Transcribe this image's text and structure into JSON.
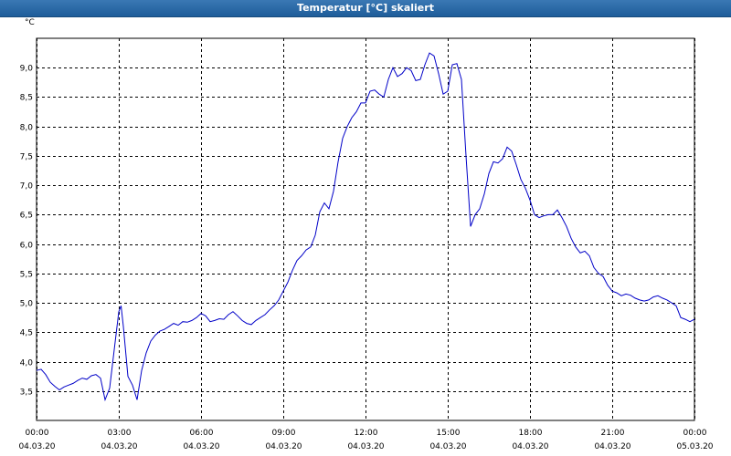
{
  "window": {
    "title": "Temperatur [°C] skaliert"
  },
  "chart_data": {
    "type": "line",
    "title": "Temperatur [°C] skaliert",
    "xlabel": "",
    "ylabel": "°C",
    "x_range_hours": [
      0,
      24
    ],
    "ylim": [
      3.0,
      9.5
    ],
    "grid": true,
    "line_color": "#0000c8",
    "y_ticks": [
      "3,5",
      "4,0",
      "4,5",
      "5,0",
      "5,5",
      "6,0",
      "6,5",
      "7,0",
      "7,5",
      "8,0",
      "8,5",
      "9,0"
    ],
    "x_ticks": [
      {
        "time": "00:00",
        "date": "04.03.20"
      },
      {
        "time": "03:00",
        "date": "04.03.20"
      },
      {
        "time": "06:00",
        "date": "04.03.20"
      },
      {
        "time": "09:00",
        "date": "04.03.20"
      },
      {
        "time": "12:00",
        "date": "04.03.20"
      },
      {
        "time": "15:00",
        "date": "04.03.20"
      },
      {
        "time": "18:00",
        "date": "04.03.20"
      },
      {
        "time": "21:00",
        "date": "04.03.20"
      },
      {
        "time": "00:00",
        "date": "05.03.20"
      }
    ],
    "series": [
      {
        "points": [
          [
            "04.03.20 00:00",
            3.85
          ],
          [
            "04.03.20 00:10",
            3.87
          ],
          [
            "04.03.20 00:20",
            3.78
          ],
          [
            "04.03.20 00:30",
            3.65
          ],
          [
            "04.03.20 00:40",
            3.58
          ],
          [
            "04.03.20 00:50",
            3.52
          ],
          [
            "04.03.20 01:00",
            3.57
          ],
          [
            "04.03.20 01:10",
            3.6
          ],
          [
            "04.03.20 01:20",
            3.63
          ],
          [
            "04.03.20 01:30",
            3.68
          ],
          [
            "04.03.20 01:40",
            3.72
          ],
          [
            "04.03.20 01:50",
            3.7
          ],
          [
            "04.03.20 02:00",
            3.76
          ],
          [
            "04.03.20 02:10",
            3.78
          ],
          [
            "04.03.20 02:20",
            3.72
          ],
          [
            "04.03.20 02:30",
            3.35
          ],
          [
            "04.03.20 02:40",
            3.55
          ],
          [
            "04.03.20 02:50",
            4.2
          ],
          [
            "04.03.20 03:00",
            4.85
          ],
          [
            "04.03.20 03:05",
            4.95
          ],
          [
            "04.03.20 03:10",
            4.6
          ],
          [
            "04.03.20 03:20",
            3.75
          ],
          [
            "04.03.20 03:30",
            3.6
          ],
          [
            "04.03.20 03:40",
            3.35
          ],
          [
            "04.03.20 03:50",
            3.85
          ],
          [
            "04.03.20 04:00",
            4.15
          ],
          [
            "04.03.20 04:10",
            4.35
          ],
          [
            "04.03.20 04:20",
            4.45
          ],
          [
            "04.03.20 04:30",
            4.52
          ],
          [
            "04.03.20 04:40",
            4.55
          ],
          [
            "04.03.20 04:50",
            4.6
          ],
          [
            "04.03.20 05:00",
            4.65
          ],
          [
            "04.03.20 05:10",
            4.62
          ],
          [
            "04.03.20 05:20",
            4.68
          ],
          [
            "04.03.20 05:30",
            4.67
          ],
          [
            "04.03.20 05:40",
            4.7
          ],
          [
            "04.03.20 05:50",
            4.75
          ],
          [
            "04.03.20 06:00",
            4.82
          ],
          [
            "04.03.20 06:10",
            4.78
          ],
          [
            "04.03.20 06:20",
            4.68
          ],
          [
            "04.03.20 06:30",
            4.7
          ],
          [
            "04.03.20 06:40",
            4.73
          ],
          [
            "04.03.20 06:50",
            4.72
          ],
          [
            "04.03.20 07:00",
            4.8
          ],
          [
            "04.03.20 07:10",
            4.85
          ],
          [
            "04.03.20 07:20",
            4.78
          ],
          [
            "04.03.20 07:30",
            4.7
          ],
          [
            "04.03.20 07:40",
            4.65
          ],
          [
            "04.03.20 07:50",
            4.63
          ],
          [
            "04.03.20 08:00",
            4.7
          ],
          [
            "04.03.20 08:10",
            4.75
          ],
          [
            "04.03.20 08:20",
            4.8
          ],
          [
            "04.03.20 08:30",
            4.88
          ],
          [
            "04.03.20 08:40",
            4.95
          ],
          [
            "04.03.20 08:50",
            5.05
          ],
          [
            "04.03.20 09:00",
            5.2
          ],
          [
            "04.03.20 09:10",
            5.35
          ],
          [
            "04.03.20 09:20",
            5.55
          ],
          [
            "04.03.20 09:30",
            5.72
          ],
          [
            "04.03.20 09:40",
            5.8
          ],
          [
            "04.03.20 09:50",
            5.9
          ],
          [
            "04.03.20 10:00",
            5.95
          ],
          [
            "04.03.20 10:10",
            6.15
          ],
          [
            "04.03.20 10:20",
            6.55
          ],
          [
            "04.03.20 10:30",
            6.7
          ],
          [
            "04.03.20 10:40",
            6.6
          ],
          [
            "04.03.20 10:50",
            6.9
          ],
          [
            "04.03.20 11:00",
            7.4
          ],
          [
            "04.03.20 11:10",
            7.8
          ],
          [
            "04.03.20 11:20",
            8.0
          ],
          [
            "04.03.20 11:30",
            8.15
          ],
          [
            "04.03.20 11:40",
            8.25
          ],
          [
            "04.03.20 11:50",
            8.4
          ],
          [
            "04.03.20 12:00",
            8.4
          ],
          [
            "04.03.20 12:10",
            8.6
          ],
          [
            "04.03.20 12:20",
            8.62
          ],
          [
            "04.03.20 12:30",
            8.55
          ],
          [
            "04.03.20 12:40",
            8.5
          ],
          [
            "04.03.20 12:50",
            8.8
          ],
          [
            "04.03.20 13:00",
            9.0
          ],
          [
            "04.03.20 13:10",
            8.85
          ],
          [
            "04.03.20 13:20",
            8.9
          ],
          [
            "04.03.20 13:30",
            9.0
          ],
          [
            "04.03.20 13:40",
            8.95
          ],
          [
            "04.03.20 13:50",
            8.78
          ],
          [
            "04.03.20 14:00",
            8.8
          ],
          [
            "04.03.20 14:10",
            9.05
          ],
          [
            "04.03.20 14:20",
            9.25
          ],
          [
            "04.03.20 14:30",
            9.2
          ],
          [
            "04.03.20 14:40",
            8.9
          ],
          [
            "04.03.20 14:50",
            8.55
          ],
          [
            "04.03.20 15:00",
            8.6
          ],
          [
            "04.03.20 15:10",
            9.05
          ],
          [
            "04.03.20 15:20",
            9.07
          ],
          [
            "04.03.20 15:30",
            8.8
          ],
          [
            "04.03.20 15:40",
            7.5
          ],
          [
            "04.03.20 15:50",
            6.3
          ],
          [
            "04.03.20 16:00",
            6.5
          ],
          [
            "04.03.20 16:10",
            6.6
          ],
          [
            "04.03.20 16:20",
            6.85
          ],
          [
            "04.03.20 16:30",
            7.2
          ],
          [
            "04.03.20 16:40",
            7.4
          ],
          [
            "04.03.20 16:50",
            7.38
          ],
          [
            "04.03.20 17:00",
            7.45
          ],
          [
            "04.03.20 17:10",
            7.65
          ],
          [
            "04.03.20 17:20",
            7.58
          ],
          [
            "04.03.20 17:30",
            7.35
          ],
          [
            "04.03.20 17:40",
            7.1
          ],
          [
            "04.03.20 17:50",
            6.95
          ],
          [
            "04.03.20 18:00",
            6.75
          ],
          [
            "04.03.20 18:10",
            6.5
          ],
          [
            "04.03.20 18:20",
            6.45
          ],
          [
            "04.03.20 18:30",
            6.48
          ],
          [
            "04.03.20 18:40",
            6.5
          ],
          [
            "04.03.20 18:50",
            6.5
          ],
          [
            "04.03.20 19:00",
            6.58
          ],
          [
            "04.03.20 19:10",
            6.45
          ],
          [
            "04.03.20 19:20",
            6.3
          ],
          [
            "04.03.20 19:30",
            6.1
          ],
          [
            "04.03.20 19:40",
            5.95
          ],
          [
            "04.03.20 19:50",
            5.85
          ],
          [
            "04.03.20 20:00",
            5.88
          ],
          [
            "04.03.20 20:10",
            5.8
          ],
          [
            "04.03.20 20:20",
            5.6
          ],
          [
            "04.03.20 20:30",
            5.5
          ],
          [
            "04.03.20 20:40",
            5.45
          ],
          [
            "04.03.20 20:50",
            5.3
          ],
          [
            "04.03.20 21:00",
            5.2
          ],
          [
            "04.03.20 21:10",
            5.17
          ],
          [
            "04.03.20 21:20",
            5.12
          ],
          [
            "04.03.20 21:30",
            5.15
          ],
          [
            "04.03.20 21:40",
            5.13
          ],
          [
            "04.03.20 21:50",
            5.08
          ],
          [
            "04.03.20 22:00",
            5.05
          ],
          [
            "04.03.20 22:10",
            5.03
          ],
          [
            "04.03.20 22:20",
            5.05
          ],
          [
            "04.03.20 22:30",
            5.1
          ],
          [
            "04.03.20 22:40",
            5.12
          ],
          [
            "04.03.20 22:50",
            5.08
          ],
          [
            "04.03.20 23:00",
            5.05
          ],
          [
            "04.03.20 23:10",
            5.0
          ],
          [
            "04.03.20 23:20",
            4.95
          ],
          [
            "04.03.20 23:30",
            4.75
          ],
          [
            "04.03.20 23:40",
            4.72
          ],
          [
            "04.03.20 23:50",
            4.68
          ],
          [
            "05.03.20 00:00",
            4.72
          ]
        ]
      }
    ]
  }
}
